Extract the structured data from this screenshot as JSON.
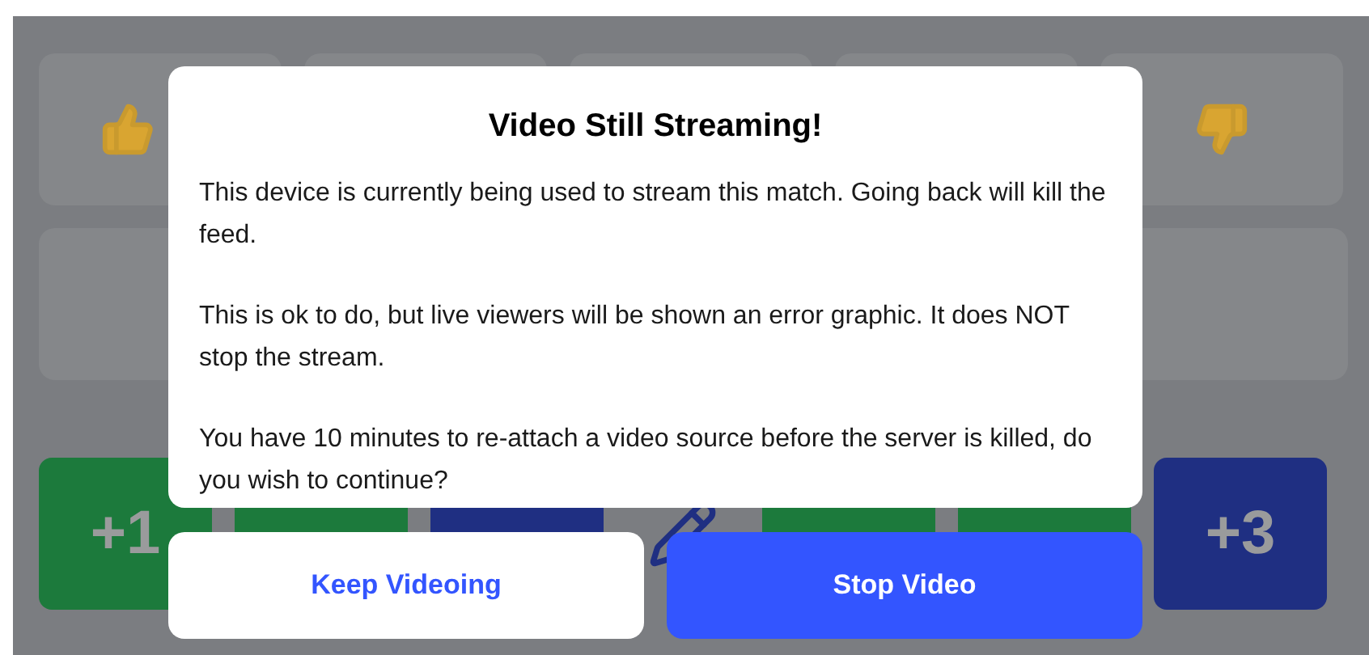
{
  "score_buttons": [
    {
      "label": "+1",
      "color": "#1c7a3c"
    },
    {
      "color": "#1c7a3c"
    },
    {
      "color": "#1f2f82"
    },
    {
      "kind": "pen"
    },
    {
      "color": "#1c7a3c"
    },
    {
      "color": "#1c7a3c"
    },
    {
      "label": "+3",
      "color": "#1f2f82"
    }
  ],
  "dialog": {
    "title": "Video Still Streaming!",
    "paragraphs": [
      "This device is currently being used to stream this match. Going back will kill the feed.",
      "This is ok to do, but live viewers will be shown an error graphic. It does NOT stop the stream.",
      "You have 10 minutes to re-attach a video source before the server is killed, do you wish to continue?"
    ],
    "buttons": [
      {
        "label": "Keep Videoing",
        "kind": "secondary"
      },
      {
        "label": "Stop Video",
        "kind": "primary"
      }
    ]
  }
}
